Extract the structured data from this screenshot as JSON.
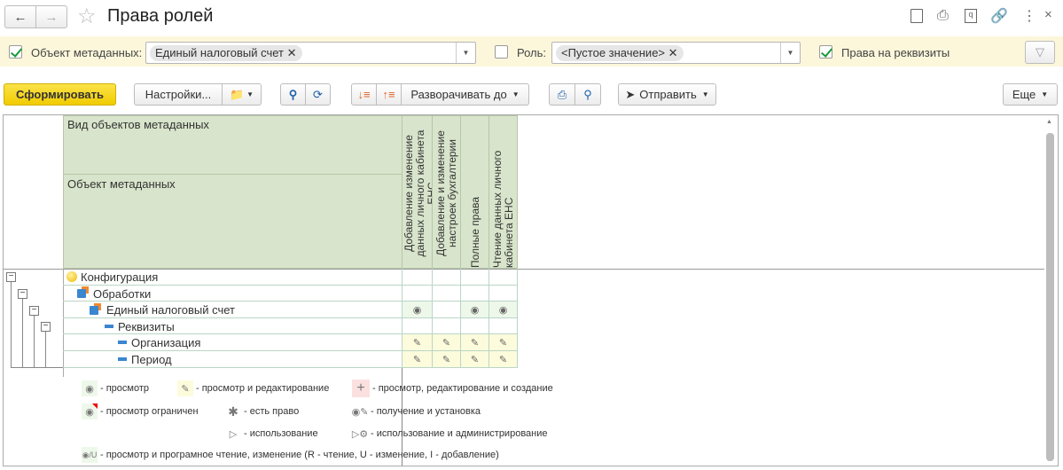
{
  "window": {
    "title": "Права ролей"
  },
  "filters": {
    "metadata_object": {
      "label": "Объект метаданных:",
      "checked": true,
      "value": "Единый налоговый счет"
    },
    "role": {
      "label": "Роль:",
      "checked": false,
      "value": "<Пустое значение>"
    },
    "attribute_rights": {
      "label": "Права на реквизиты",
      "checked": true
    }
  },
  "toolbar": {
    "generate": "Сформировать",
    "settings": "Настройки...",
    "expand_to": "Разворачивать до",
    "send": "Отправить",
    "more": "Еще"
  },
  "report": {
    "header": {
      "kind": "Вид объектов метаданных",
      "object": "Объект метаданных",
      "columns": [
        "Добавление изменение данных личного кабинета ЕНС",
        "Добавление и изменение настроек бухгалтерии",
        "Полные права",
        "Чтение данных личного кабинета ЕНС"
      ]
    },
    "rows": [
      {
        "label": "Конфигурация",
        "icon": "configuration-icon",
        "cells": [
          "",
          "",
          "",
          ""
        ]
      },
      {
        "label": "Обработки",
        "icon": "data-processor-icon",
        "cells": [
          "",
          "",
          "",
          ""
        ]
      },
      {
        "label": "Единый налоговый счет",
        "icon": "data-processor-icon",
        "cells": [
          "view",
          "",
          "view",
          "view"
        ]
      },
      {
        "label": "Реквизиты",
        "icon": "attribute-icon",
        "cells": [
          "",
          "",
          "",
          ""
        ]
      },
      {
        "label": "Организация",
        "icon": "attribute-icon",
        "cells": [
          "edit",
          "edit",
          "edit",
          "edit"
        ]
      },
      {
        "label": "Период",
        "icon": "attribute-icon",
        "cells": [
          "edit",
          "edit",
          "edit",
          "edit"
        ]
      }
    ]
  },
  "legend": {
    "view": "- просмотр",
    "edit": "- просмотр и редактирование",
    "create": "- просмотр, редактирование и создание",
    "view_limited": "- просмотр ограничен",
    "has_right": "- есть право",
    "get_set": "- получение и установка",
    "use": "- использование",
    "use_admin": "- использование и администрирование",
    "view_prog": "- просмотр и програмное чтение, изменение (R - чтение, U - изменение, I - добавление)",
    "u_letter": "U"
  }
}
